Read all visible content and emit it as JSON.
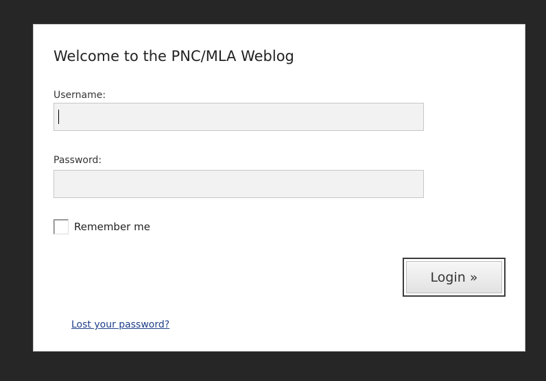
{
  "login": {
    "title": "Welcome to the PNC/MLA Weblog",
    "username_label": "Username:",
    "username_value": "",
    "password_label": "Password:",
    "password_value": "",
    "remember_label": "Remember me",
    "remember_checked": false,
    "submit_label": "Login »",
    "lost_password_label": "Lost your password?"
  },
  "colors": {
    "background": "#262626",
    "panel": "#ffffff",
    "field_fill": "#f2f2f2",
    "link": "#1f3f8a"
  }
}
